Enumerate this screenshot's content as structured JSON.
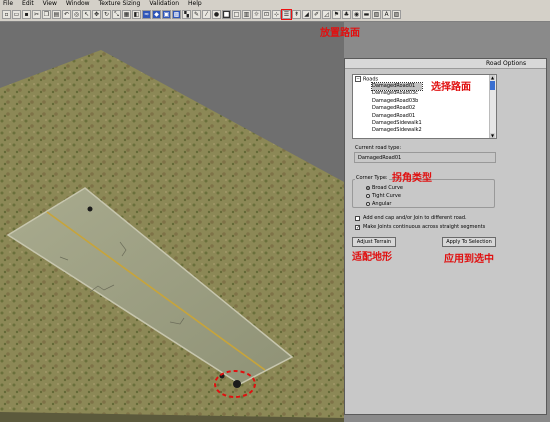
{
  "menu": [
    "File",
    "Edit",
    "View",
    "Window",
    "Texture Sizing",
    "Validation",
    "Help"
  ],
  "toolbar": {
    "buttons": [
      "new",
      "open",
      "save",
      "cut",
      "copy",
      "paste",
      "undo",
      "select",
      "pointer",
      "move",
      "rotate",
      "scale",
      "grid",
      "camera",
      "water",
      "object",
      "layer",
      "texture",
      "snap",
      "paint",
      "brush",
      "place",
      "terrain",
      "square",
      "cliff",
      "light",
      "trigger",
      "waypoint",
      "path",
      "road",
      "measure",
      "pen",
      "slope",
      "flag",
      "rock",
      "eye",
      "cam",
      "map",
      "ai",
      "heights"
    ]
  },
  "annotations": {
    "place_road": "放置路面",
    "select_road": "选择路面",
    "corner_type": "拐角类型",
    "adjust_terrain": "适配地形",
    "apply_selection": "应用到选中"
  },
  "panel": {
    "title": "Road Options",
    "tree_root": "Roads",
    "road_items": [
      "DamagedRoad01",
      "DamagedRoad03c",
      "DamagedRoad03b",
      "DamagedRoad02",
      "DamagedRoad01",
      "DamagedSidewalk1",
      "DamagedSidewalk2"
    ],
    "selected_index": 0,
    "current_road_label": "Current road type:",
    "current_road_value": "DamagedRoad01",
    "corner_type_label": "Corner Type:",
    "corner_options": [
      "Broad Curve",
      "Tight Curve",
      "Angular"
    ],
    "corner_selected": 0,
    "checkbox_endcap": "Add end cap and/or Join to different road.",
    "checkbox_endcap_checked": false,
    "checkbox_joints": "Make Joints continuous across straight segments",
    "checkbox_joints_checked": true,
    "adjust_button": "Adjust Terrain",
    "apply_button": "Apply To Selection"
  },
  "colors": {
    "annotation": "#e01010",
    "panel_bg": "#c8c8c8",
    "selection": "#3a6fd0"
  }
}
